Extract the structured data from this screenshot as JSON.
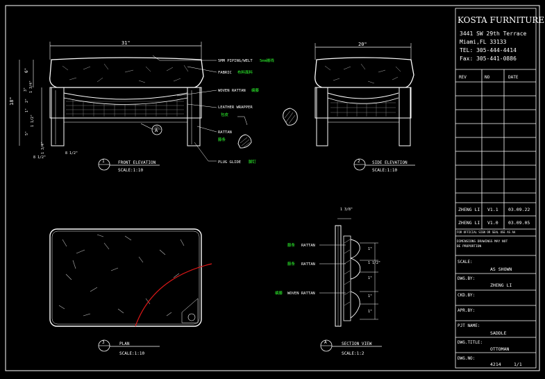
{
  "title_block": {
    "company": "KOSTA FURNITURE",
    "address_line1": "3441 SW 29th Terrace",
    "address_line2": "Miami,FL   33133",
    "tel": "TEL:   305-444-4414",
    "fax": "Fax:   305-441-0886",
    "rev_header": "REV",
    "no_header": "NO",
    "date_header": "DATE",
    "revisions": [
      {
        "name": "ZHENG LI",
        "version": "V1.1",
        "date": "03.09.22"
      },
      {
        "name": "ZHENG LI",
        "version": "V1.0",
        "date": "03.09.05"
      }
    ],
    "note1": "FOR OFFICIAL SIGN OR SEAL USE AS AA",
    "note2a": "DIMENSIONS DRAWINGS MAY NOT",
    "note2b": "BE PROPORTION",
    "scale_label": "SCALE:",
    "scale_value": "AS SHOWN",
    "drawn_by_label": "DWG.BY:",
    "drawn_by_value": "ZHENG LI",
    "checked_label": "CKD.BY:",
    "approved_label": "APR.BY:",
    "project_label": "PJT NAME:",
    "project_value": "SADDLE",
    "title_label": "DWG.TITLE:",
    "title_value": "OTTOMAN",
    "dwg_no_label": "DWG.NO:",
    "dwg_no_value": "4214",
    "sheet_value": "1/1"
  },
  "front_view": {
    "title": "FRONT ELEVATION",
    "scale": "SCALE:1:10",
    "number": "1",
    "width_dim": "31\"",
    "dims_left": [
      "18\"",
      "6\"",
      "3\"",
      "1 3/4\"",
      "2\"",
      "1\"",
      "1 1/2\"",
      "5\"",
      "1 3/4\""
    ],
    "dims_bottom": [
      "8 1/2\"",
      "8 1/2\""
    ],
    "callout": "A"
  },
  "callouts": [
    {
      "en": "5MM PIPING/WELT",
      "cn": "5mm嵌线"
    },
    {
      "en": "FABRIC",
      "cn": "布料面料"
    },
    {
      "en": "WOVEN RATTAN",
      "cn": "编藤"
    },
    {
      "en": "LEATHER WRAPPER",
      "cn": "包皮"
    },
    {
      "en": "RATTAN",
      "cn": "藤条"
    },
    {
      "en": "PLUG GLIDE",
      "cn": "脚钉"
    }
  ],
  "side_view": {
    "title": "SIDE ELEVATION",
    "scale": "SCALE:1:10",
    "number": "2",
    "width_dim": "20\""
  },
  "plan_view": {
    "title": "PLAN",
    "scale": "SCALE:1:10",
    "number": "3"
  },
  "section_view": {
    "title": "SECTION VIEW",
    "scale": "SCALE:1:2",
    "number": "A",
    "top_dim": "1 3/8\"",
    "labels": [
      {
        "cn": "藤条",
        "en": "RATTAN"
      },
      {
        "cn": "藤条",
        "en": "RATTAN"
      },
      {
        "cn": "编藤",
        "en": "WOVEN RATTAN"
      }
    ],
    "right_dims": [
      "1\"",
      "1 1/2\"",
      "1\"",
      "1\"",
      "1\""
    ]
  },
  "colors": {
    "background": "#000000",
    "line": "#ffffff",
    "chinese_text": "#2fff2f",
    "accent_red": "#e01818"
  }
}
